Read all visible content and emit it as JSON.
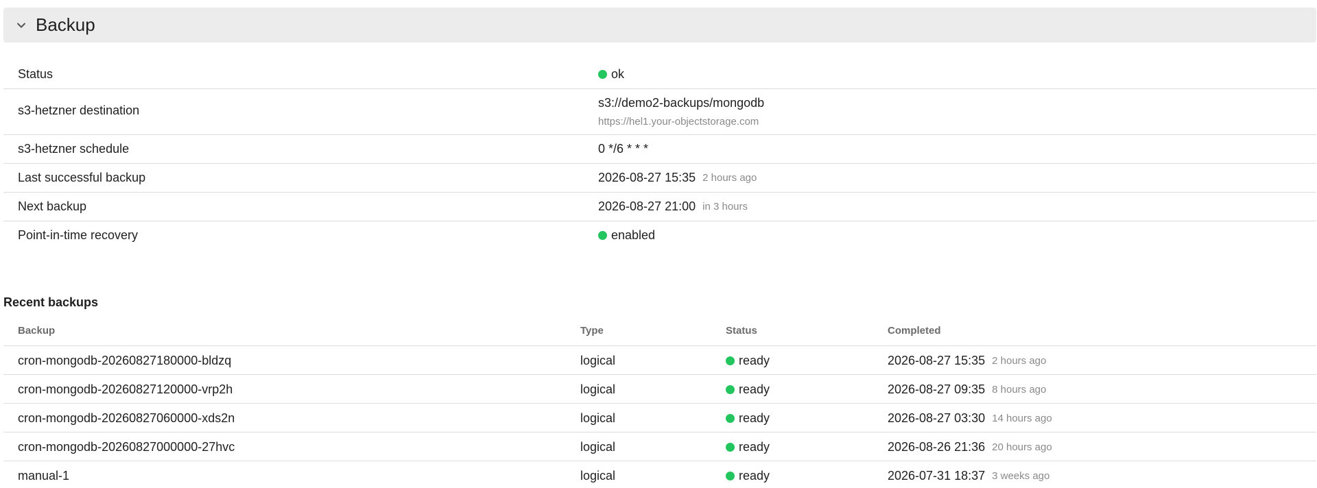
{
  "section": {
    "title": "Backup"
  },
  "details": {
    "status": {
      "label": "Status",
      "value": "ok",
      "color": "#22c55e"
    },
    "destination": {
      "label": "s3-hetzner destination",
      "value": "s3://demo2-backups/mongodb",
      "url": "https://hel1.your-objectstorage.com"
    },
    "schedule": {
      "label": "s3-hetzner schedule",
      "value": "0 */6 * * *"
    },
    "last_backup": {
      "label": "Last successful backup",
      "value": "2026-08-27 15:35",
      "relative": "2 hours ago"
    },
    "next_backup": {
      "label": "Next backup",
      "value": "2026-08-27 21:00",
      "relative": "in 3 hours"
    },
    "pitr": {
      "label": "Point-in-time recovery",
      "value": "enabled",
      "color": "#22c55e"
    }
  },
  "recent": {
    "title": "Recent backups",
    "columns": [
      "Backup",
      "Type",
      "Status",
      "Completed"
    ],
    "rows": [
      {
        "backup": "cron-mongodb-20260827180000-bldzq",
        "type": "logical",
        "status": "ready",
        "completed": "2026-08-27 15:35",
        "relative": "2 hours ago"
      },
      {
        "backup": "cron-mongodb-20260827120000-vrp2h",
        "type": "logical",
        "status": "ready",
        "completed": "2026-08-27 09:35",
        "relative": "8 hours ago"
      },
      {
        "backup": "cron-mongodb-20260827060000-xds2n",
        "type": "logical",
        "status": "ready",
        "completed": "2026-08-27 03:30",
        "relative": "14 hours ago"
      },
      {
        "backup": "cron-mongodb-20260827000000-27hvc",
        "type": "logical",
        "status": "ready",
        "completed": "2026-08-26 21:36",
        "relative": "20 hours ago"
      },
      {
        "backup": "manual-1",
        "type": "logical",
        "status": "ready",
        "completed": "2026-07-31 18:37",
        "relative": "3 weeks ago"
      }
    ],
    "status_color": "#22c55e"
  }
}
